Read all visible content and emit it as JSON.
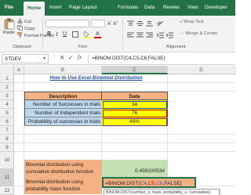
{
  "ribbon": {
    "tabs": [
      "File",
      "Home",
      "Insert",
      "Page Layout",
      "Formulas",
      "Data",
      "Review",
      "View",
      "Developer"
    ],
    "active_tab": "Home",
    "clipboard": {
      "paste_label": "Paste",
      "cut_label": "Cut",
      "copy_label": "Copy",
      "format_painter_label": "Format Painter",
      "group_label": "Clipboard"
    },
    "font": {
      "group_label": "Font",
      "bold": "B",
      "italic": "I",
      "underline": "U",
      "font_color": "A"
    },
    "alignment": {
      "group_label": "Alignment",
      "wrap_text": "Wrap Text",
      "merge_center": "Merge & Center"
    }
  },
  "formula_bar": {
    "name_box": "STDEV",
    "cancel_glyph": "✕",
    "enter_glyph": "✓",
    "fx_label": "fx",
    "formula": "=BINOM.DIST(C4,C5,C6,FALSE)"
  },
  "grid": {
    "columns": [
      "A",
      "B",
      "C",
      "D"
    ],
    "selected_column": "C",
    "rows": [
      "1",
      "2",
      "3",
      "4",
      "5",
      "6",
      "7",
      "8",
      "9",
      "10",
      "11",
      "12"
    ],
    "selected_row": "11"
  },
  "sheet": {
    "title": "How to Use Excel Binomial Distribution",
    "table_header": {
      "description": "Description",
      "data": "Data"
    },
    "table_rows": [
      {
        "description": "Number of Successes in trials",
        "value": "34"
      },
      {
        "description": "Number of Independent trials",
        "value": "76"
      },
      {
        "description": "Probability of successes in trials",
        "value": "46%"
      }
    ],
    "cdf_label": "Binomial distribution using cumulative distribution function",
    "cdf_value": "0.459100534",
    "pmf_label": "Binomial distribution using probability mass function",
    "pmf_formula": {
      "prefix": "=BINOM.DIST(",
      "arg1": "C4",
      "comma1": ",",
      "arg2": "C5",
      "comma2": ",",
      "arg3": "C6",
      "suffix": ",FALSE]"
    },
    "tooltip": "BINOM.DIST(number_s, trials, probability_s, cumulative)"
  },
  "colors": {
    "excel_green": "#217346",
    "orange_fill": "#f4b183",
    "blue_fill": "#bdd7ee",
    "yellow_fill": "#ffff00",
    "green_fill": "#c5e0b3",
    "ref_blue": "#1f4eb4",
    "ref_red": "#c00000",
    "ref_purple": "#7030a0"
  }
}
